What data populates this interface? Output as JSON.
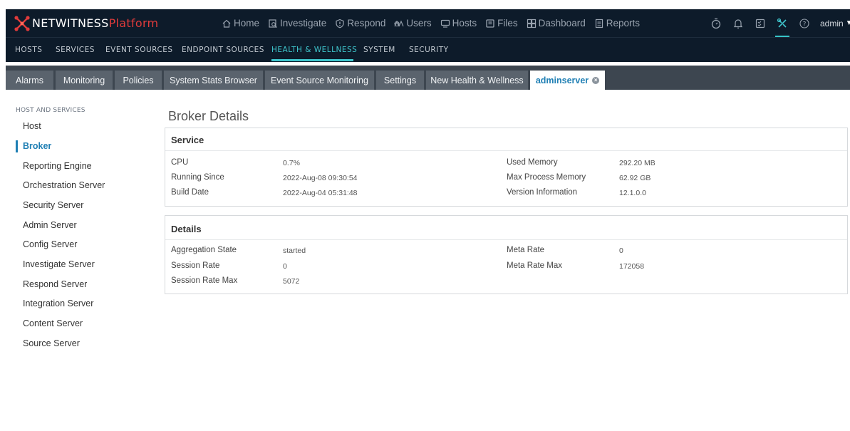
{
  "brand": {
    "name": "NETWITNESS",
    "suffix": "Platform"
  },
  "main_nav": [
    {
      "label": "Home",
      "icon": "home-icon"
    },
    {
      "label": "Investigate",
      "icon": "investigate-icon"
    },
    {
      "label": "Respond",
      "icon": "respond-icon"
    },
    {
      "label": "Users",
      "icon": "users-icon"
    },
    {
      "label": "Hosts",
      "icon": "hosts-icon"
    },
    {
      "label": "Files",
      "icon": "files-icon"
    },
    {
      "label": "Dashboard",
      "icon": "dashboard-icon"
    },
    {
      "label": "Reports",
      "icon": "reports-icon"
    }
  ],
  "right_icons": [
    "timer-icon",
    "bell-icon",
    "checklist-icon",
    "tools-icon",
    "help-icon"
  ],
  "user": {
    "name": "admin"
  },
  "sub_nav": [
    "HOSTS",
    "SERVICES",
    "EVENT SOURCES",
    "ENDPOINT SOURCES",
    "HEALTH & WELLNESS",
    "SYSTEM",
    "SECURITY"
  ],
  "sub_nav_active": "HEALTH & WELLNESS",
  "tabs": [
    "Alarms",
    "Monitoring",
    "Policies",
    "System Stats Browser",
    "Event Source Monitoring",
    "Settings",
    "New Health & Wellness",
    "adminserver"
  ],
  "active_tab": "adminserver",
  "sidebar": {
    "heading": "HOST AND SERVICES",
    "items": [
      "Host",
      "Broker",
      "Reporting Engine",
      "Orchestration Server",
      "Security Server",
      "Admin Server",
      "Config Server",
      "Investigate Server",
      "Respond Server",
      "Integration Server",
      "Content Server",
      "Source Server"
    ],
    "active": "Broker"
  },
  "page_title": "Broker Details",
  "service": {
    "title": "Service",
    "left": [
      {
        "label": "CPU",
        "value": "0.7%"
      },
      {
        "label": "Running Since",
        "value": "2022-Aug-08 09:30:54"
      },
      {
        "label": "Build Date",
        "value": "2022-Aug-04 05:31:48"
      }
    ],
    "right": [
      {
        "label": "Used Memory",
        "value": "292.20 MB"
      },
      {
        "label": "Max Process Memory",
        "value": "62.92 GB"
      },
      {
        "label": "Version Information",
        "value": "12.1.0.0"
      }
    ]
  },
  "details": {
    "title": "Details",
    "left": [
      {
        "label": "Aggregation State",
        "value": "started"
      },
      {
        "label": "Session Rate",
        "value": "0"
      },
      {
        "label": "Session Rate Max",
        "value": "5072"
      }
    ],
    "right": [
      {
        "label": "Meta Rate",
        "value": "0"
      },
      {
        "label": "Meta Rate Max",
        "value": "172058"
      }
    ]
  },
  "colors": {
    "topbar": "#0d1b2a",
    "accent": "#3fc5cc",
    "link": "#1f7fb4",
    "brand_red": "#e03b3b",
    "tabbar": "#3d4650",
    "tab": "#5a636d"
  }
}
